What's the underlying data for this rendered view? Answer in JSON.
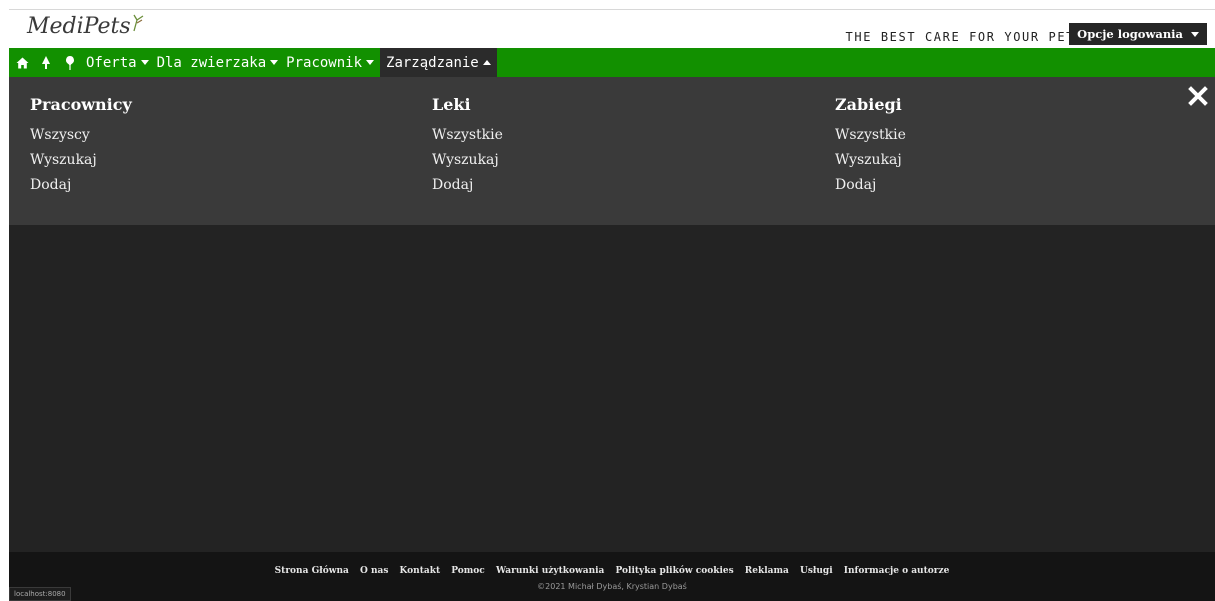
{
  "brand": {
    "logo_text": "MediPets",
    "tagline": "THE BEST CARE FOR YOUR PET"
  },
  "header": {
    "login_label": "Opcje logowania"
  },
  "nav": {
    "icons": [
      "home-icon",
      "tree-icon",
      "pin-icon"
    ],
    "items": [
      {
        "label": "Oferta"
      },
      {
        "label": "Dla zwierzaka"
      },
      {
        "label": "Pracownik"
      },
      {
        "label": "Zarządzanie"
      }
    ]
  },
  "menu": {
    "columns": [
      {
        "title": "Pracownicy",
        "links": [
          "Wszyscy",
          "Wyszukaj",
          "Dodaj"
        ]
      },
      {
        "title": "Leki",
        "links": [
          "Wszystkie",
          "Wyszukaj",
          "Dodaj"
        ]
      },
      {
        "title": "Zabiegi",
        "links": [
          "Wszystkie",
          "Wyszukaj",
          "Dodaj"
        ]
      }
    ]
  },
  "footer": {
    "links": [
      "Strona Główna",
      "O nas",
      "Kontakt",
      "Pomoc",
      "Warunki użytkowania",
      "Polityka plików cookies",
      "Reklama",
      "Usługi",
      "Informacje o autorze"
    ],
    "copyright": "©2021 Michał Dybaś, Krystian Dybaś"
  },
  "status_bar": {
    "url": "localhost:8080"
  },
  "colors": {
    "nav_green": "#129000",
    "mega_bg": "#3a3a3a",
    "page_bg": "#232323",
    "footer_bg": "#141414"
  }
}
